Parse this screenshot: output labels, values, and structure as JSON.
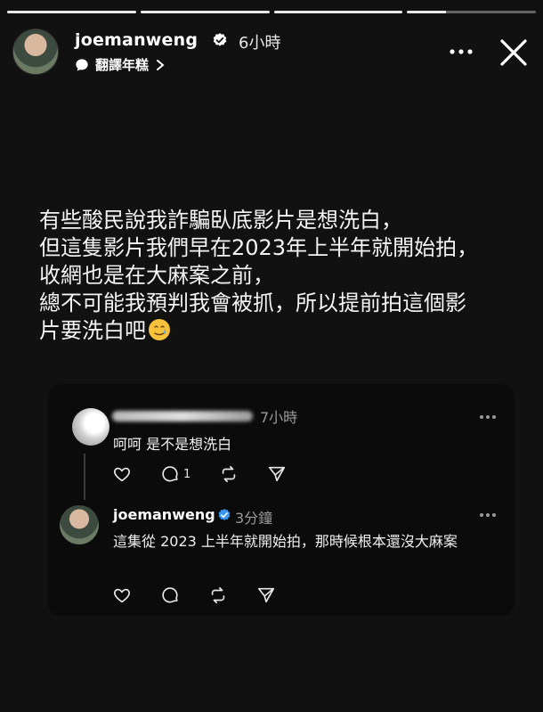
{
  "story": {
    "progress_segments": [
      1,
      1,
      1,
      0.3
    ]
  },
  "header": {
    "username": "joemanweng",
    "time": "6小時",
    "translate_label": "翻譯年糕",
    "icons": [
      "avatar",
      "verified-icon",
      "more-icon",
      "close-icon",
      "speech-bubble-icon",
      "chevron-right-icon"
    ]
  },
  "caption": {
    "lines": [
      "有些酸民說我詐騙臥底影片是想洗白，",
      "但這隻影片我們早在2023年上半年就開始拍，",
      "收網也是在大麻案之前，",
      "總不可能我預判我會被抓，所以提前拍這個影",
      "片要洗白吧"
    ]
  },
  "card": {
    "comment1": {
      "time": "7小時",
      "text": "呵呵 是不是想洗白",
      "reply_count": "1"
    },
    "comment2": {
      "username": "joemanweng",
      "time": "3分鐘",
      "text": "這集從 2023 上半年就開始拍，那時候根本還沒大麻案"
    }
  },
  "colors": {
    "background": "#111111",
    "verified": "#3897f0"
  }
}
